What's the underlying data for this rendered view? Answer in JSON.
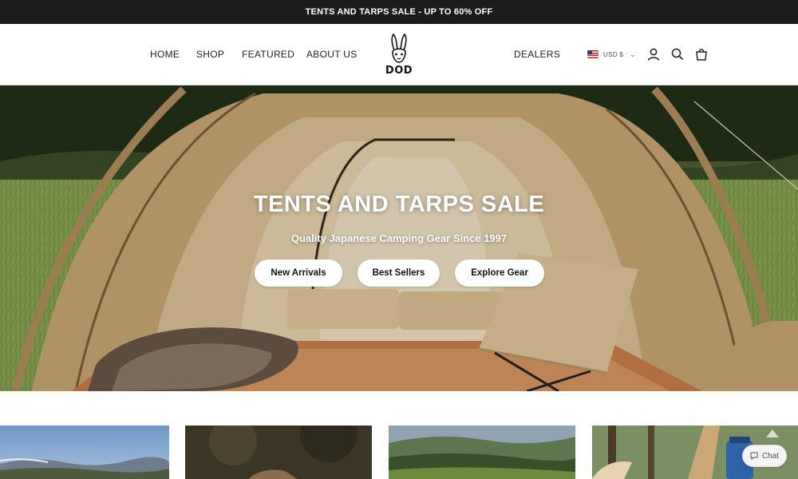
{
  "announcement": {
    "text": "TENTS AND TARPS SALE - UP TO 60% OFF"
  },
  "nav": {
    "left": [
      {
        "label": "HOME"
      },
      {
        "label": "SHOP"
      },
      {
        "label": "FEATURED"
      },
      {
        "label": "ABOUT US"
      }
    ],
    "right": [
      {
        "label": "DEALERS"
      }
    ]
  },
  "logo": {
    "text": "DOD",
    "icon": "rabbit-logo"
  },
  "currency": {
    "label": "USD $",
    "flag": "us-flag-icon"
  },
  "header_icons": [
    {
      "name": "account-icon"
    },
    {
      "name": "search-icon"
    },
    {
      "name": "cart-icon"
    }
  ],
  "hero": {
    "title": "TENTS AND TARPS SALE",
    "subtitle": "Quality Japanese Camping Gear Since 1997",
    "buttons": [
      {
        "label": "New Arrivals"
      },
      {
        "label": "Best Sellers"
      },
      {
        "label": "Explore Gear"
      }
    ]
  },
  "chat": {
    "label": "Chat",
    "icon": "chat-bubble-icon"
  },
  "colors": {
    "announcement_bg": "#1c1c1c",
    "tent": "#d8b888",
    "button_bg": "#ffffff"
  }
}
